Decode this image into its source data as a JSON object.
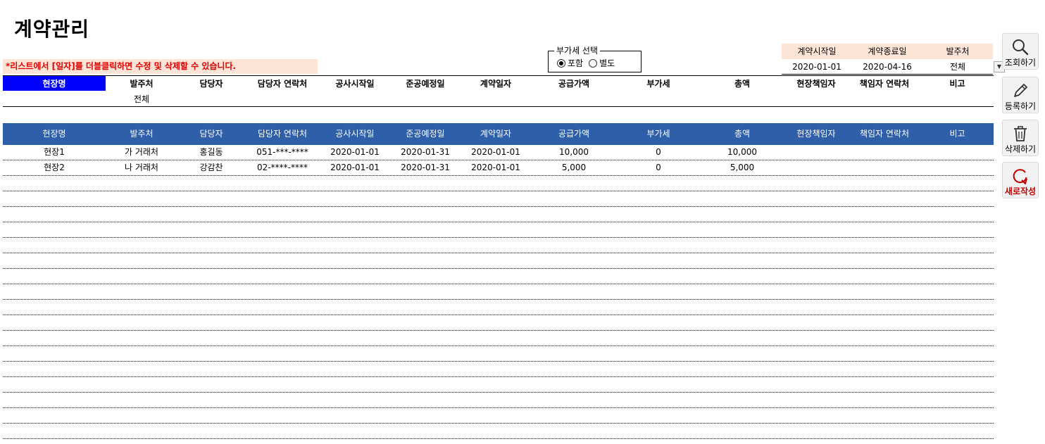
{
  "title": "계약관리",
  "notice": "*리스트에서 [일자]를 더블클릭하면 수정 및 삭제할 수 있습니다.",
  "vat": {
    "legend": "부가세 선택",
    "options": [
      {
        "label": "포함",
        "selected": true
      },
      {
        "label": "별도",
        "selected": false
      }
    ]
  },
  "filter": {
    "headers": [
      "계약시작일",
      "계약종료일",
      "발주처"
    ],
    "values": [
      "2020-01-01",
      "2020-04-16",
      "전체"
    ]
  },
  "columns": [
    "현장명",
    "발주처",
    "담당자",
    "담당자 연락처",
    "공사시작일",
    "준공예정일",
    "계약일자",
    "공급가액",
    "부가세",
    "총액",
    "현장책임자",
    "책임자 연락처",
    "비고"
  ],
  "search_values": [
    "",
    "전체",
    "",
    "",
    "",
    "",
    "",
    "",
    "",
    "",
    "",
    "",
    ""
  ],
  "rows": [
    [
      "현장1",
      "가 거래처",
      "홍길동",
      "051-***-****",
      "2020-01-01",
      "2020-01-31",
      "2020-01-01",
      "10,000",
      "0",
      "10,000",
      "",
      "",
      ""
    ],
    [
      "현장2",
      "나 거래처",
      "강감찬",
      "02-****-****",
      "2020-01-01",
      "2020-01-31",
      "2020-01-01",
      "5,000",
      "0",
      "5,000",
      "",
      "",
      ""
    ]
  ],
  "empty_rows": 17,
  "side_buttons": [
    {
      "label": "조회하기",
      "icon": "search-icon"
    },
    {
      "label": "등록하기",
      "icon": "pencil-icon"
    },
    {
      "label": "삭제하기",
      "icon": "trash-icon"
    },
    {
      "label": "새로작성",
      "icon": "refresh-icon"
    }
  ],
  "colors": {
    "header_blue": "#2e5fa8",
    "highlight_blue": "#0000ff",
    "peach": "#fce4d6",
    "notice_red": "#e00000"
  }
}
